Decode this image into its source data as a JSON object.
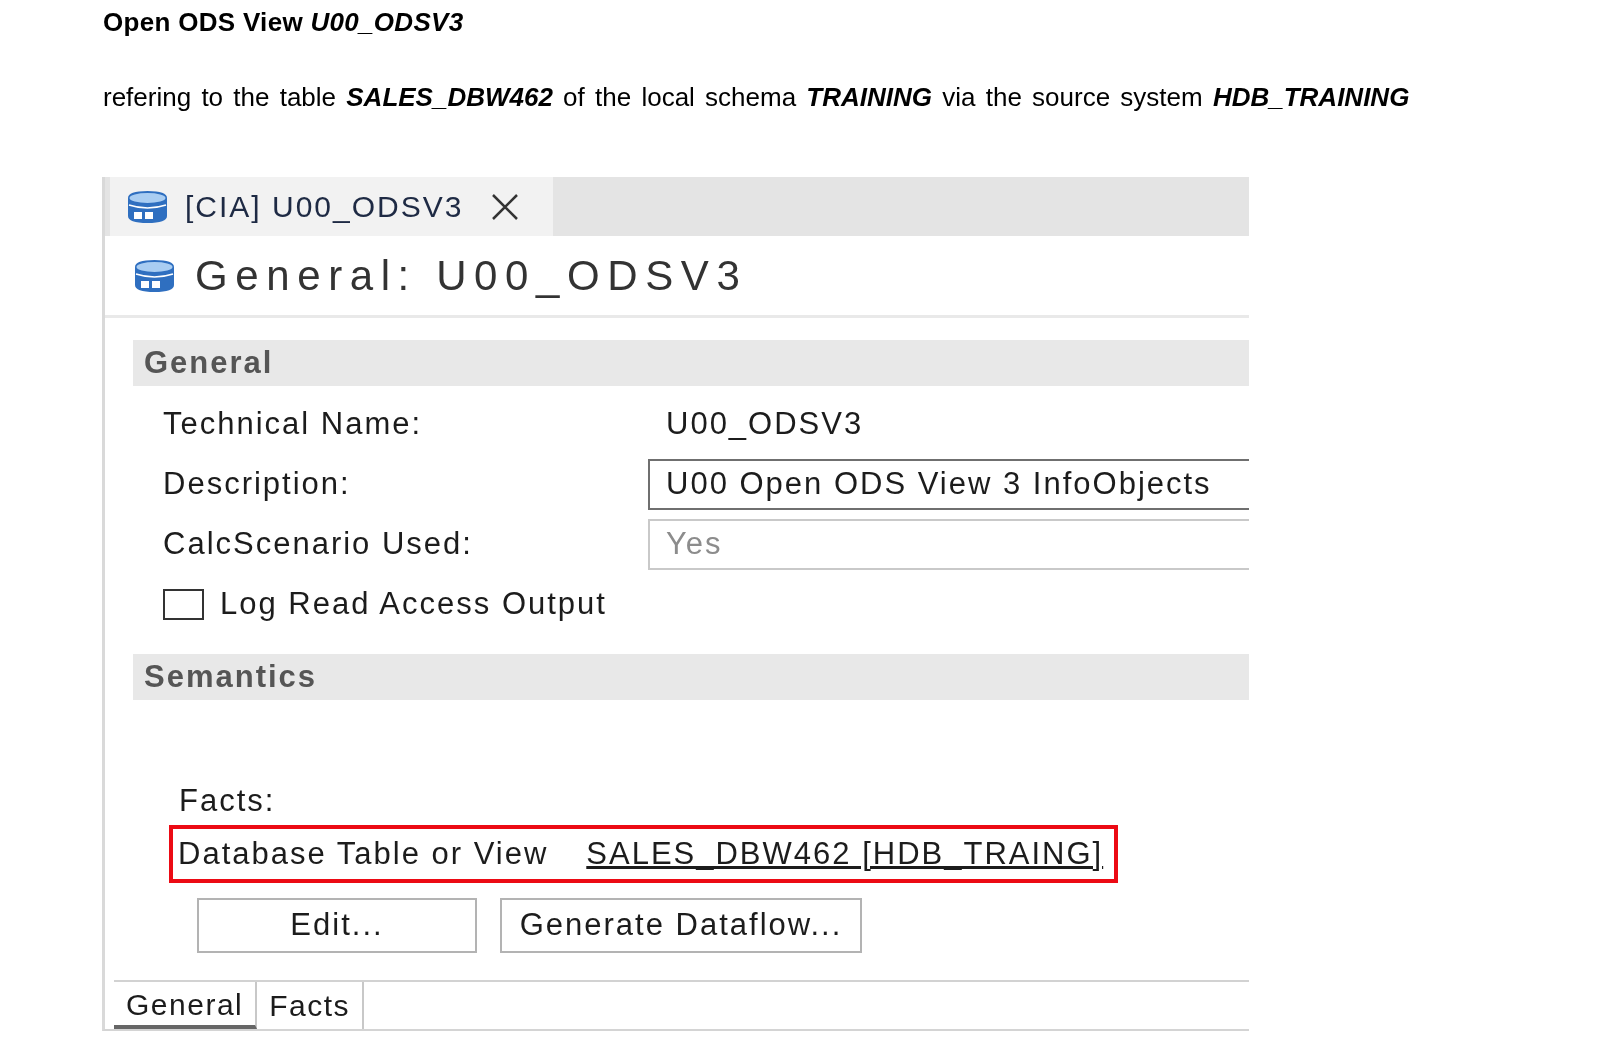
{
  "document": {
    "heading": "Open ODS View *U00_ODSV3*",
    "paragraph": "refering to the table **SALES_DBW462** of the local schema **TRAINING** via the source system **HDB_TRAINING**"
  },
  "editor": {
    "tabs": [
      {
        "label": "[CIA] U00_ODSV3",
        "selected": true,
        "closable": true
      }
    ],
    "title": "General: U00_ODSV3",
    "general": {
      "title": "General",
      "fields": [
        {
          "kind": "text",
          "label": "Technical Name:",
          "value": "U00_ODSV3"
        },
        {
          "kind": "input",
          "label": "Description:",
          "value": "U00 Open ODS View 3 InfoObjects",
          "disabled": false
        },
        {
          "kind": "input",
          "label": "CalcScenario Used:",
          "value": "Yes",
          "disabled": true
        },
        {
          "kind": "checkbox",
          "label": "Log Read Access Output",
          "checked": false
        }
      ]
    },
    "semantics": {
      "title": "Semantics",
      "facts_label": "Facts:",
      "source": {
        "label": "Database Table or View",
        "link": "SALES_DBW462 [HDB_TRAING]",
        "highlighted": true
      },
      "buttons": [
        "Edit...",
        "Generate Dataflow..."
      ]
    },
    "bottom_tabs": [
      {
        "label": "General",
        "selected": true
      },
      {
        "label": "Facts",
        "selected": false
      }
    ]
  }
}
